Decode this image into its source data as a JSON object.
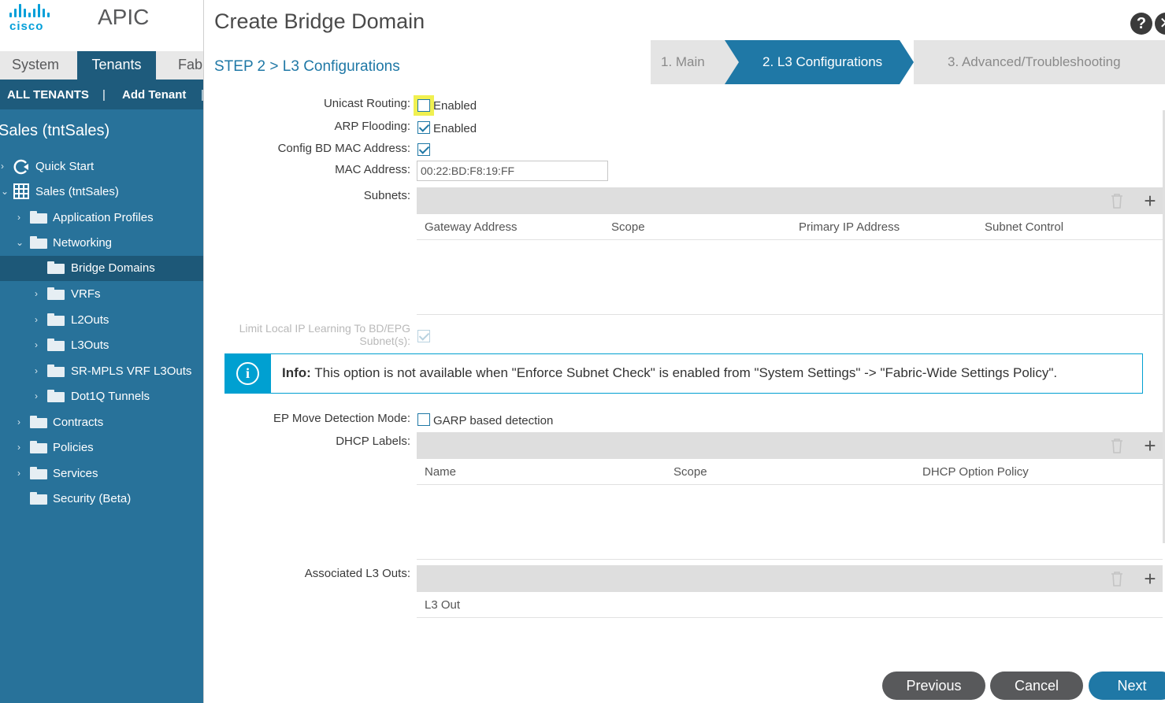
{
  "app": {
    "brand": "cisco",
    "title": "APIC"
  },
  "nav_tabs": [
    "System",
    "Tenants",
    "Fabric"
  ],
  "subbar": {
    "all_tenants": "ALL TENANTS",
    "separator": "|",
    "add_tenant": "Add Tenant",
    "separator2": "|"
  },
  "sidebar": {
    "tenant_title": "Sales (tntSales)",
    "items": [
      {
        "label": "Quick Start",
        "icon": "quick-start-icon"
      },
      {
        "label": "Sales (tntSales)",
        "icon": "tenant-grid-icon"
      },
      {
        "label": "Application Profiles",
        "icon": "folder-icon"
      },
      {
        "label": "Networking",
        "icon": "folder-icon"
      },
      {
        "label": "Bridge Domains",
        "icon": "folder-icon",
        "selected": true
      },
      {
        "label": "VRFs",
        "icon": "folder-icon"
      },
      {
        "label": "L2Outs",
        "icon": "folder-icon"
      },
      {
        "label": "L3Outs",
        "icon": "folder-icon"
      },
      {
        "label": "SR-MPLS VRF L3Outs",
        "icon": "folder-icon"
      },
      {
        "label": "Dot1Q Tunnels",
        "icon": "folder-icon"
      },
      {
        "label": "Contracts",
        "icon": "folder-icon"
      },
      {
        "label": "Policies",
        "icon": "folder-icon"
      },
      {
        "label": "Services",
        "icon": "folder-icon"
      },
      {
        "label": "Security (Beta)",
        "icon": "folder-icon"
      }
    ]
  },
  "dialog": {
    "title": "Create Bridge Domain",
    "help": "?",
    "close": "✕",
    "step_label": "STEP 2 > L3 Configurations",
    "wizard": [
      "1. Main",
      "2. L3 Configurations",
      "3. Advanced/Troubleshooting"
    ],
    "fields": {
      "unicast_routing": {
        "label": "Unicast Routing:",
        "text": "Enabled",
        "checked": false
      },
      "arp_flooding": {
        "label": "ARP Flooding:",
        "text": "Enabled",
        "checked": true
      },
      "config_bd_mac": {
        "label": "Config BD MAC Address:",
        "checked": true
      },
      "mac_address": {
        "label": "MAC Address:",
        "value": "00:22:BD:F8:19:FF"
      },
      "subnets": {
        "label": "Subnets:",
        "columns": [
          "Gateway Address",
          "Scope",
          "Primary IP Address",
          "Subnet Control"
        ]
      },
      "limit_local_ip": {
        "label_line1": "Limit Local IP Learning To BD/EPG",
        "label_line2": "Subnet(s):",
        "checked": true,
        "disabled": true
      },
      "info": {
        "bold": "Info:",
        "text": " This option is not available when \"Enforce Subnet Check\" is enabled from \"System Settings\" -> \"Fabric-Wide Settings Policy\"."
      },
      "ep_move": {
        "label": "EP Move Detection Mode:",
        "text": "GARP based detection",
        "checked": false
      },
      "dhcp_labels": {
        "label": "DHCP Labels:",
        "columns": [
          "Name",
          "Scope",
          "DHCP Option Policy"
        ]
      },
      "associated_l3outs": {
        "label": "Associated L3 Outs:",
        "columns": [
          "L3 Out"
        ]
      }
    },
    "buttons": {
      "previous": "Previous",
      "cancel": "Cancel",
      "next": "Next"
    }
  },
  "colors": {
    "accent": "#1f78a6",
    "sidebar": "#28729a",
    "info": "#00a0d1",
    "highlight": "#f0f050"
  }
}
